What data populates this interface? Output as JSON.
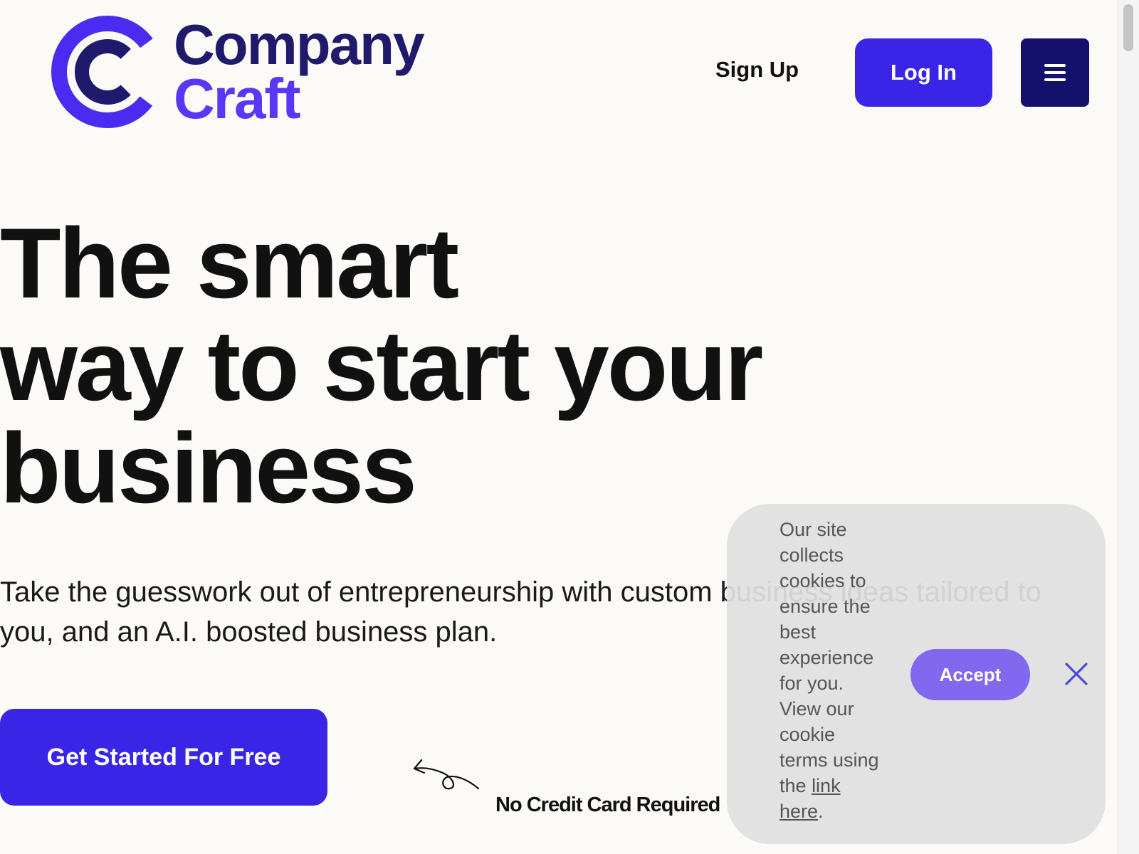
{
  "header": {
    "logo": {
      "word1": "Company",
      "word2": "Craft"
    },
    "signup_label": "Sign Up",
    "login_label": "Log In",
    "menu_icon": "hamburger-menu-icon"
  },
  "hero": {
    "headline_lines": [
      "The smart",
      "way to start your",
      "business"
    ],
    "subtext": "Take the guesswork out of entrepreneurship with custom business ideas tailored to you, and an A.I. boosted business plan.",
    "cta_label": "Get Started For Free",
    "note": "No Credit Card Required"
  },
  "cookie_banner": {
    "text": "Our site collects cookies to ensure the best experience for you. View our cookie terms using the",
    "link_text": "link here",
    "after_link": ".",
    "accept_label": "Accept",
    "close_icon": "close-icon"
  },
  "colors": {
    "primary": "#3a25e6",
    "navy": "#15106b",
    "logo_dark": "#1f1a6b",
    "logo_light": "#5a37f5",
    "accept": "#8168ef",
    "background": "#fbfaf7"
  }
}
